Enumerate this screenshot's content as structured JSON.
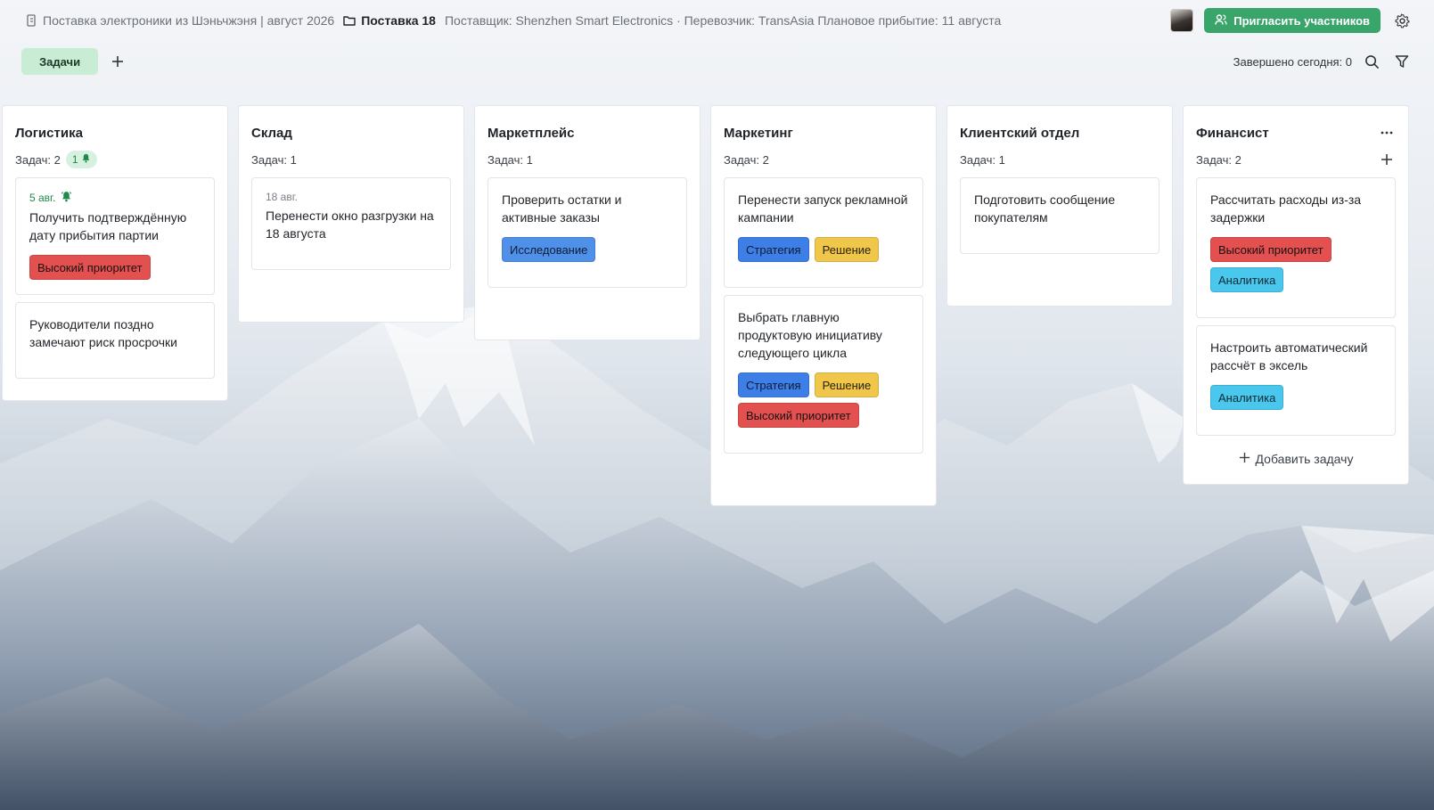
{
  "header": {
    "project": "Поставка электроники из Шэньчжэня | август 2026",
    "folder": "Поставка 18",
    "description": "Поставщик: Shenzhen Smart Electronics · Перевозчик: TransAsia Плановое прибытие: 11 августа",
    "invite_label": "Пригласить участников"
  },
  "viewbar": {
    "tab_label": "Задачи",
    "completed_today": "Завершено сегодня: 0"
  },
  "columns": [
    {
      "title": "Логистика",
      "count": "Задач: 2",
      "badge": "1",
      "cards": [
        {
          "date": "5 авг.",
          "title": "Получить подтверждённую дату прибытия партии",
          "tags": [
            "Высокий приоритет"
          ]
        },
        {
          "date": "",
          "title": "Руководители поздно замечают риск просрочки",
          "tags": []
        }
      ]
    },
    {
      "title": "Склад",
      "count": "Задач: 1",
      "cards": [
        {
          "date": "18 авг.",
          "title": "Перенести окно разгрузки на 18 августа",
          "tags": []
        }
      ]
    },
    {
      "title": "Маркетплейс",
      "count": "Задач: 1",
      "cards": [
        {
          "date": "",
          "title": "Проверить остатки и активные заказы",
          "tags": [
            "Исследование"
          ]
        }
      ]
    },
    {
      "title": "Маркетинг",
      "count": "Задач: 2",
      "cards": [
        {
          "date": "",
          "title": "Перенести запуск рекламной кампании",
          "tags": [
            "Стратегия",
            "Решение"
          ]
        },
        {
          "date": "",
          "title": "Выбрать главную продуктовую инициативу следующего цикла",
          "tags": [
            "Стратегия",
            "Решение",
            "Высокий приоритет"
          ]
        }
      ]
    },
    {
      "title": "Клиентский отдел",
      "count": "Задач: 1",
      "cards": [
        {
          "date": "",
          "title": "Подготовить сообщение покупателям",
          "tags": []
        }
      ]
    },
    {
      "title": "Финансист",
      "count": "Задач: 2",
      "add_task": "Добавить задачу",
      "cards": [
        {
          "date": "",
          "title": "Рассчитать расходы из-за задержки",
          "tags": [
            "Высокий приоритет",
            "Аналитика"
          ]
        },
        {
          "date": "",
          "title": "Настроить автоматический рассчёт в эксель",
          "tags": [
            "Аналитика"
          ]
        }
      ]
    }
  ],
  "tag_colors": {
    "Высокий приоритет": "#e25050",
    "Стратегия": "#3d7fe6",
    "Исследование": "#4f90e8",
    "Решение": "#f0c74a",
    "Аналитика": "#49c7ec"
  },
  "icons": {
    "project": "project-icon",
    "folder": "folder-icon",
    "invite": "users-icon",
    "settings": "gear-icon",
    "add_view": "plus-icon",
    "search": "search-icon",
    "filter": "filter-icon",
    "bell": "bell-icon",
    "column_more": "more-icon",
    "column_add": "plus-icon"
  }
}
